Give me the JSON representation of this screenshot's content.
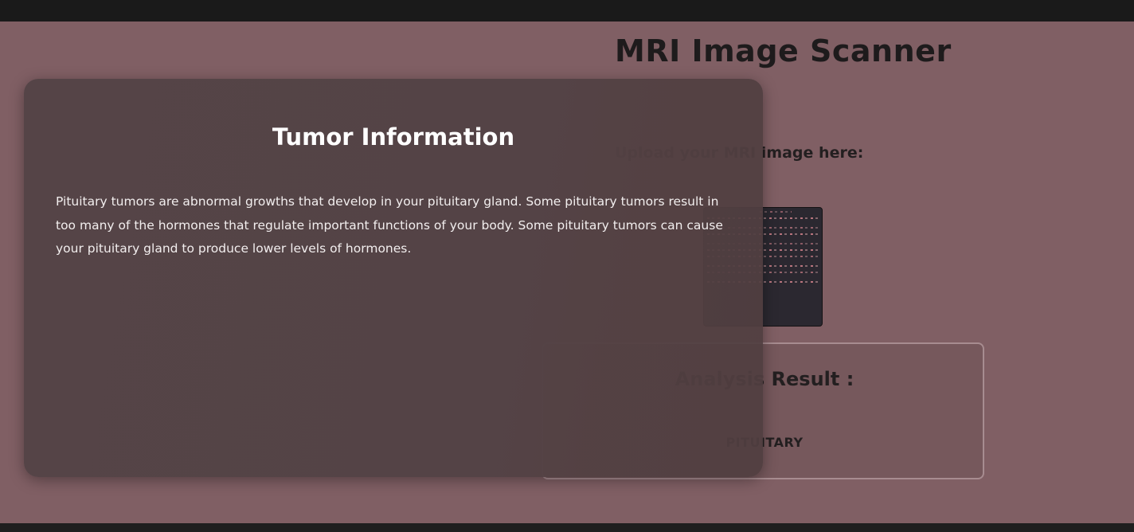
{
  "header": {
    "title": "MRI Image Scanner"
  },
  "upload": {
    "label": "Upload your MRI image here:"
  },
  "result": {
    "title": "Analysis Result :",
    "value": "PITUITARY"
  },
  "modal": {
    "title": "Tumor Information",
    "body": "Pituitary tumors are abnormal growths that develop in your pituitary gland. Some pituitary tumors result in too many of the hormones that regulate important functions of your body. Some pituitary tumors can cause your pituitary gland to produce lower levels of hormones."
  },
  "colors": {
    "background": "#805f64",
    "modal": "#554447",
    "topbar": "#1a1a1a"
  }
}
